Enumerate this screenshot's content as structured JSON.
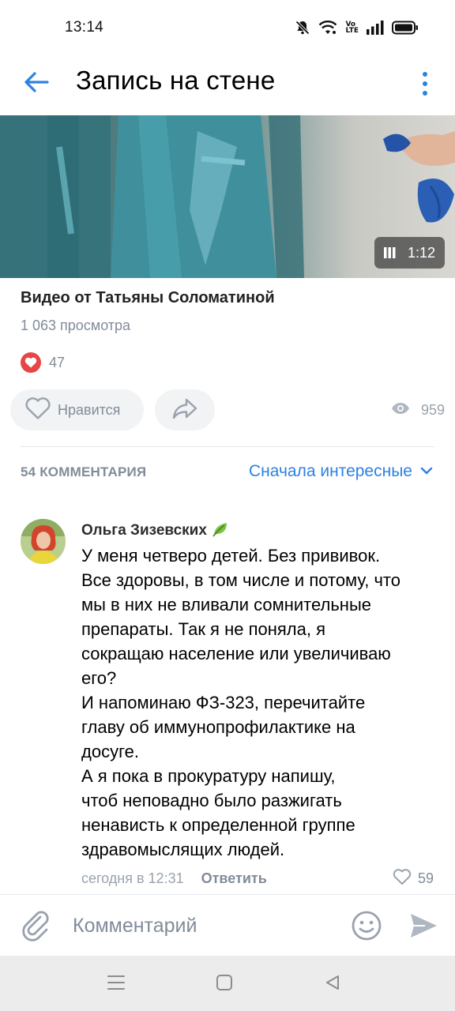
{
  "status_bar": {
    "time": "13:14",
    "icons": [
      "mute-bell-icon",
      "wifi-icon",
      "volte-icon",
      "signal-icon",
      "battery-icon"
    ],
    "volte_top": "Vo",
    "volte_bottom": "LTE"
  },
  "header": {
    "title": "Запись на стене",
    "back_icon": "arrow-left-icon",
    "more_icon": "more-vertical-icon"
  },
  "video": {
    "duration": "1:12",
    "duration_icon": "pause-bars-icon",
    "title": "Видео от Татьяны Соломатиной",
    "views": "1 063 просмотра"
  },
  "reactions": {
    "icon": "heart-reaction-icon",
    "count": "47"
  },
  "actions": {
    "like_label": "Нравится",
    "like_icon": "heart-outline-icon",
    "share_icon": "share-icon",
    "views_icon": "eye-icon",
    "views_count": "959"
  },
  "comments": {
    "header": "54 КОММЕНТАРИЯ",
    "sort_label": "Сначала интересные",
    "sort_icon": "chevron-down-icon",
    "items": [
      {
        "author": "Ольга Зизевских",
        "author_badge_icon": "leaf-emoji-icon",
        "text": "У меня четверо детей. Без прививок.\nВсе здоровы, в том числе и потому, что\nмы в них не вливали сомнительные\nпрепараты. Так я не поняла, я\nсокращаю население или увеличиваю\nего?\nИ напоминаю ФЗ-323, перечитайте\nглаву об иммунопрофилактике на\nдосуге.\nА я пока в прокуратуру напишу,\nчтоб неповадно было разжигать\nненависть к определенной группе\nздравомыслящих людей.",
        "date": "сегодня в 12:31",
        "reply_label": "Ответить",
        "likes": "59"
      }
    ]
  },
  "composer": {
    "placeholder": "Комментарий",
    "attach_icon": "paperclip-icon",
    "emoji_icon": "smile-icon",
    "send_icon": "send-icon"
  },
  "nav_bar": {
    "icons": [
      "menu-icon",
      "home-square-icon",
      "back-triangle-icon"
    ]
  },
  "colors": {
    "accent": "#2d81e0",
    "secondary_text": "#818c99",
    "like_red": "#e64646",
    "button_bg": "#f2f3f5"
  }
}
